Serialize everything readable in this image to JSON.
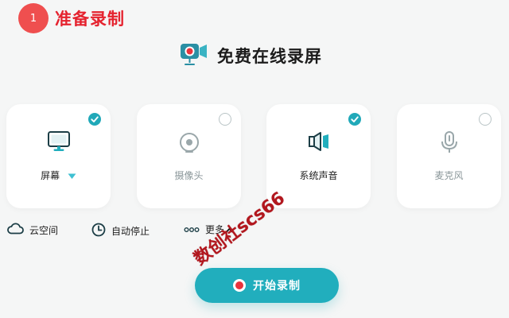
{
  "step": {
    "number": "1",
    "title": "准备录制"
  },
  "app": {
    "title": "免费在线录屏",
    "icon": "video-camera-icon"
  },
  "sources": [
    {
      "label": "屏幕",
      "icon": "monitor-icon",
      "selected": true
    },
    {
      "label": "摄像头",
      "icon": "webcam-icon",
      "selected": false
    },
    {
      "label": "系统声音",
      "icon": "speaker-icon",
      "selected": true
    },
    {
      "label": "麦克风",
      "icon": "microphone-icon",
      "selected": false
    }
  ],
  "options": {
    "cloud": {
      "label": "云空间",
      "icon": "cloud-icon"
    },
    "auto_stop": {
      "label": "自动停止",
      "icon": "clock-icon"
    },
    "more": {
      "label": "更多",
      "icon": "dots-icon"
    }
  },
  "start_button": {
    "label": "开始录制"
  },
  "watermark": "数创社scs66",
  "colors": {
    "accent": "#21aebd",
    "step_red": "#e5232f",
    "record_red": "#e8333c",
    "background": "#f5f6f6"
  }
}
